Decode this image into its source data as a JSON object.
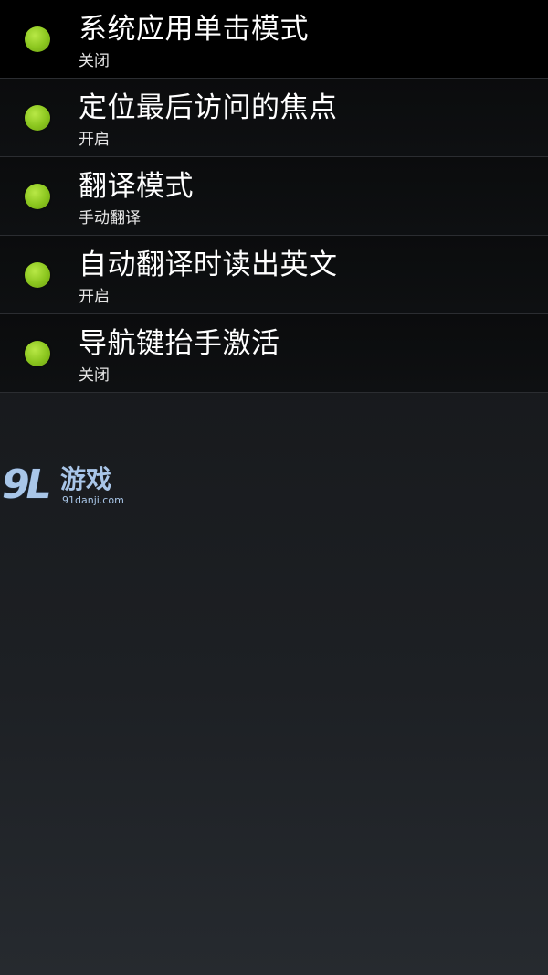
{
  "settings": [
    {
      "title": "系统应用单击模式",
      "value": "关闭"
    },
    {
      "title": "定位最后访问的焦点",
      "value": "开启"
    },
    {
      "title": "翻译模式",
      "value": "手动翻译"
    },
    {
      "title": "自动翻译时读出英文",
      "value": "开启"
    },
    {
      "title": "导航键抬手激活",
      "value": "关闭"
    }
  ],
  "watermark": {
    "mark": "9L",
    "name": "游戏",
    "url": "91danji.com"
  },
  "colors": {
    "indicator": "#8ac51e",
    "background": "#17191c"
  }
}
